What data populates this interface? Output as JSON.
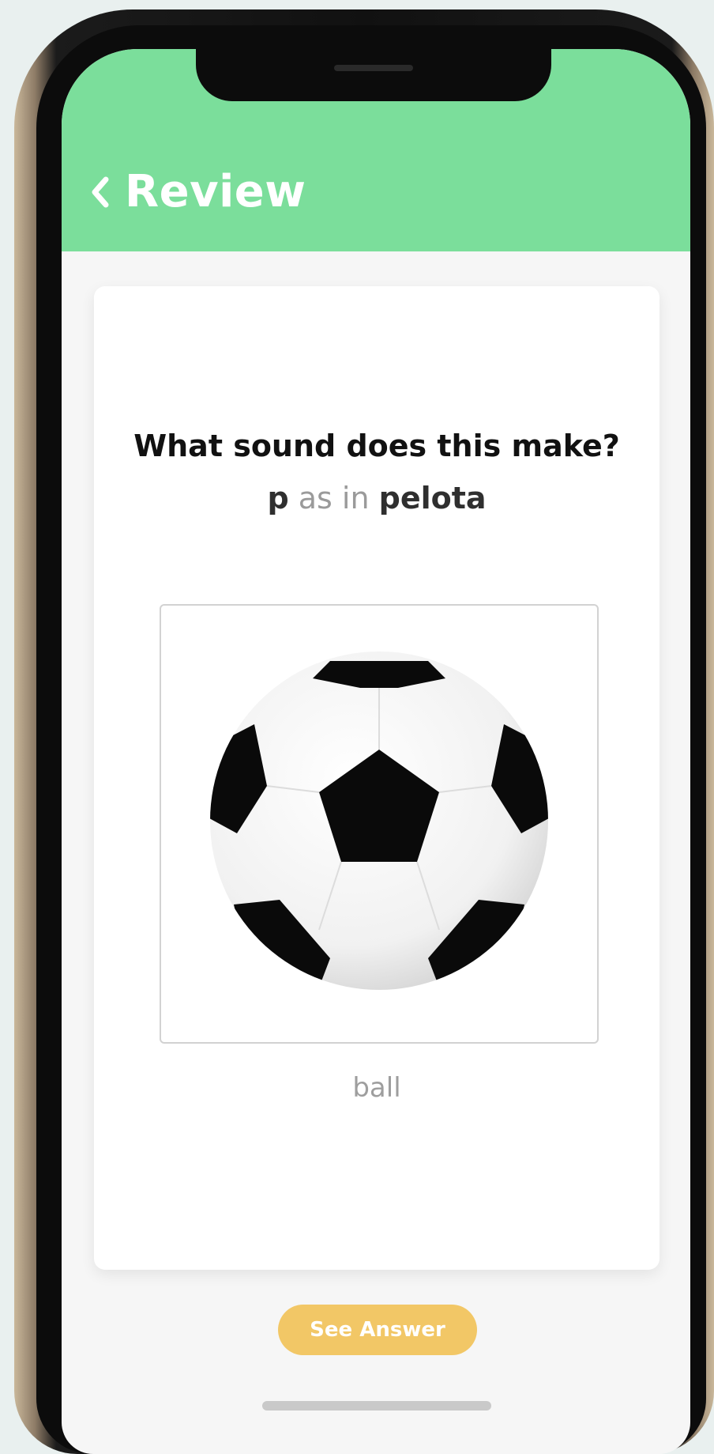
{
  "header": {
    "back_label": "Review",
    "color": "#7bde9b"
  },
  "card": {
    "prompt": "What sound does this make?",
    "letter": "p",
    "connector": "as in",
    "word": "pelota",
    "image_icon": "soccer-ball",
    "caption": "ball"
  },
  "actions": {
    "see_answer_label": "See Answer",
    "see_answer_color": "#f2c766"
  }
}
